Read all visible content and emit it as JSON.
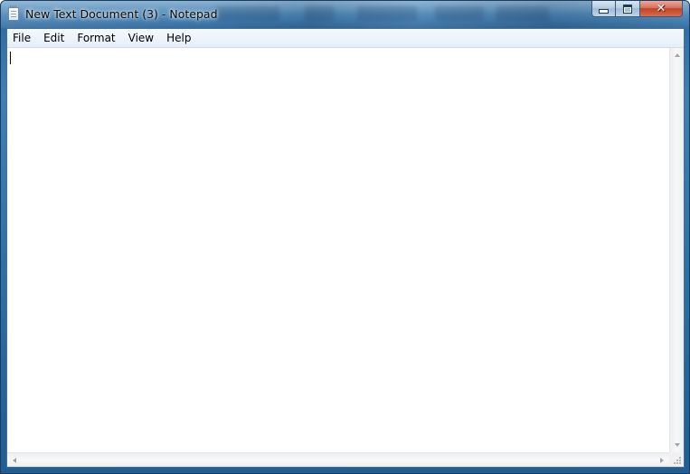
{
  "window": {
    "title": "New Text Document (3) - Notepad",
    "icon": "notepad-icon",
    "controls": {
      "minimize_icon": "minimize-icon",
      "maximize_icon": "maximize-icon",
      "close_icon": "close-icon",
      "close_glyph": "✕"
    }
  },
  "menu": {
    "items": [
      {
        "label": "File"
      },
      {
        "label": "Edit"
      },
      {
        "label": "Format"
      },
      {
        "label": "View"
      },
      {
        "label": "Help"
      }
    ]
  },
  "editor": {
    "content": ""
  },
  "colors": {
    "titlebar": "#2f6fa6",
    "close_button": "#c2432a",
    "menubar": "#e6eef8",
    "editor_bg": "#ffffff"
  }
}
